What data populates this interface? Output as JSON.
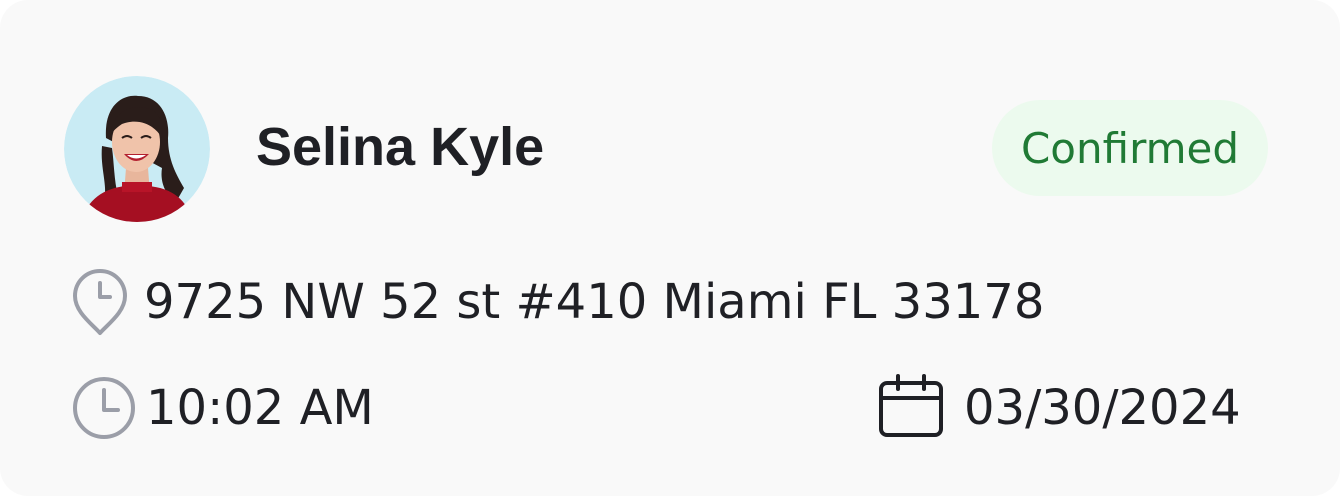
{
  "contact": {
    "name": "Selina Kyle",
    "status": "Confirmed",
    "address": "9725 NW 52 st #410 Miami FL 33178",
    "time": "10:02 AM",
    "date": "03/30/2024"
  },
  "icons": {
    "address": "location-pin-clock-icon",
    "time": "clock-icon",
    "date": "calendar-icon"
  },
  "colors": {
    "card_background": "#f9f9f9",
    "badge_background": "#ecfaee",
    "badge_text": "#207a35",
    "text": "#1f2025",
    "muted_icon": "#9b9ea8",
    "avatar_background": "#c9ebf4"
  }
}
